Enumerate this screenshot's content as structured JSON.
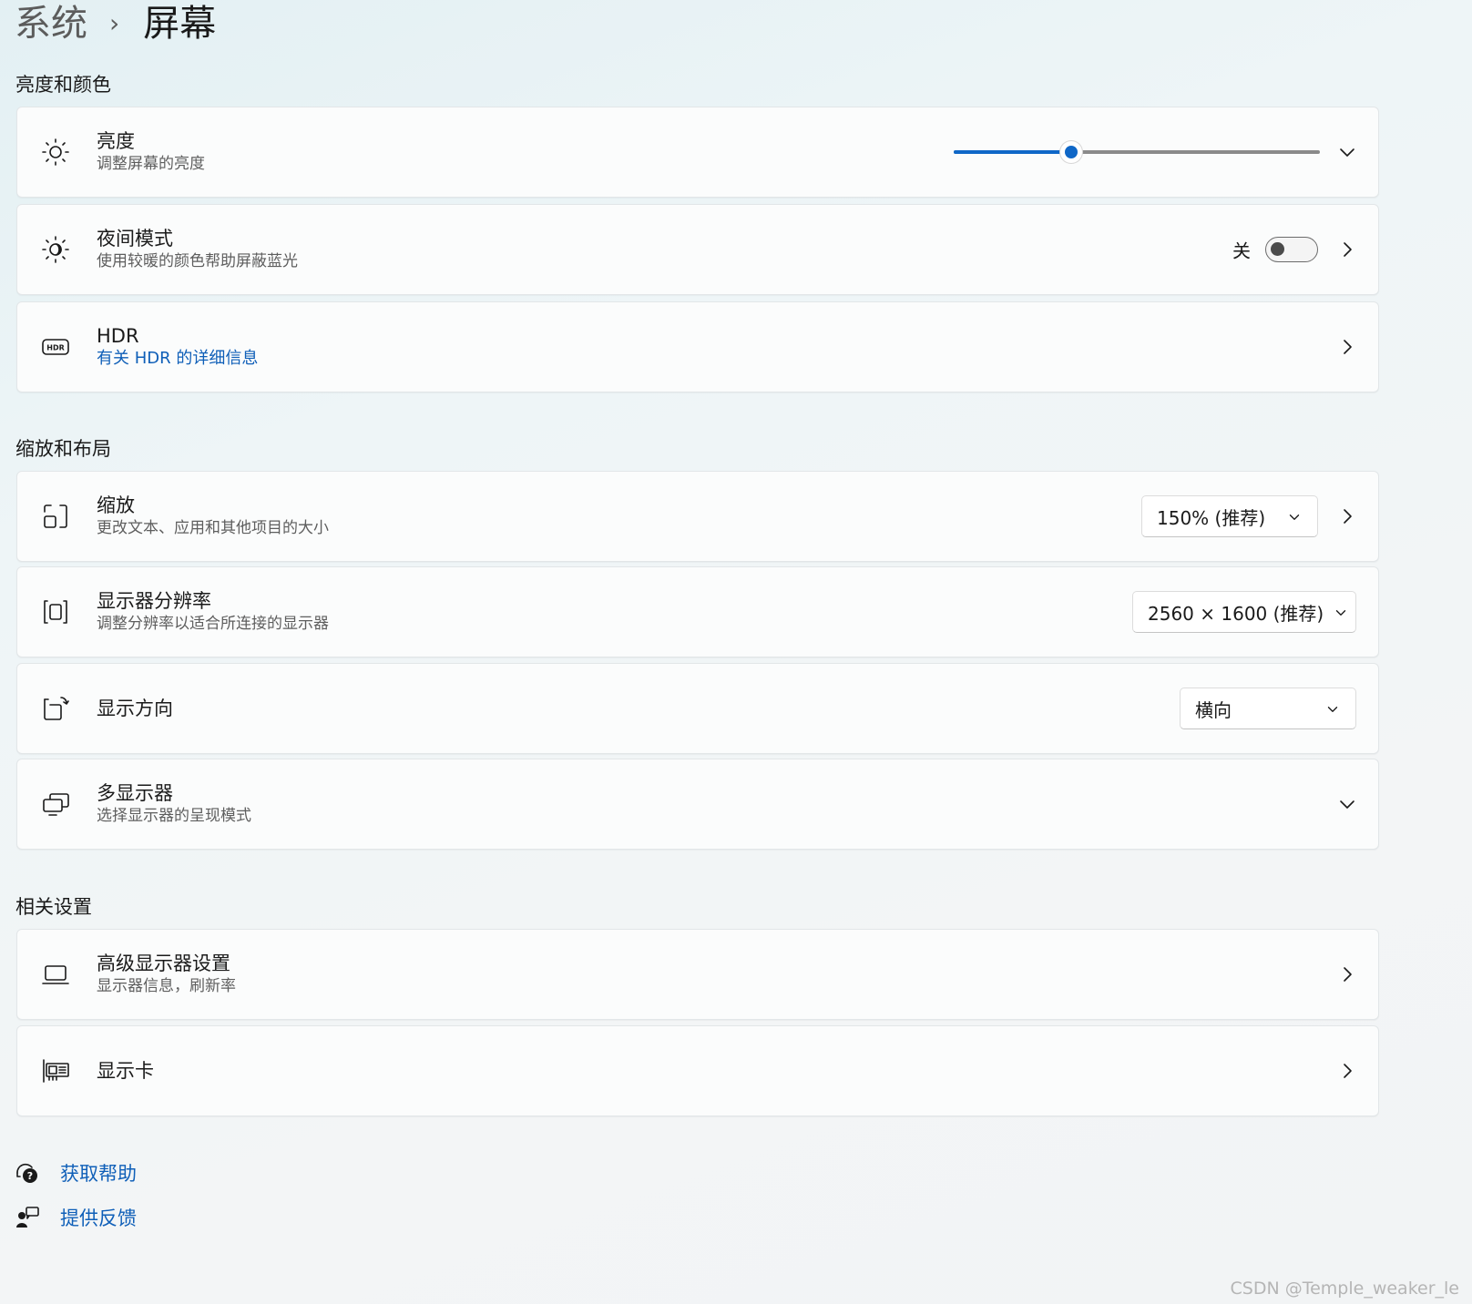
{
  "breadcrumb": {
    "parent": "系统",
    "separator": "›",
    "current": "屏幕"
  },
  "sections": {
    "brightness_color": "亮度和颜色",
    "scale_layout": "缩放和布局",
    "related": "相关设置"
  },
  "brightness": {
    "title": "亮度",
    "subtitle": "调整屏幕的亮度",
    "level": 0.32
  },
  "night_light": {
    "title": "夜间模式",
    "subtitle": "使用较暖的颜色帮助屏蔽蓝光",
    "state_label": "关",
    "on": false
  },
  "hdr": {
    "title": "HDR",
    "link": "有关 HDR 的详细信息"
  },
  "scale": {
    "title": "缩放",
    "subtitle": "更改文本、应用和其他项目的大小",
    "value": "150% (推荐)"
  },
  "resolution": {
    "title": "显示器分辨率",
    "subtitle": "调整分辨率以适合所连接的显示器",
    "value": "2560 × 1600 (推荐)"
  },
  "orientation": {
    "title": "显示方向",
    "value": "横向"
  },
  "multi_display": {
    "title": "多显示器",
    "subtitle": "选择显示器的呈现模式"
  },
  "advanced_display": {
    "title": "高级显示器设置",
    "subtitle": "显示器信息，刷新率"
  },
  "graphics": {
    "title": "显示卡"
  },
  "footer": {
    "help": "获取帮助",
    "feedback": "提供反馈"
  },
  "watermark": "CSDN @Temple_weaker_le",
  "colors": {
    "accent": "#0f67c7",
    "link": "#0f5fb8"
  }
}
